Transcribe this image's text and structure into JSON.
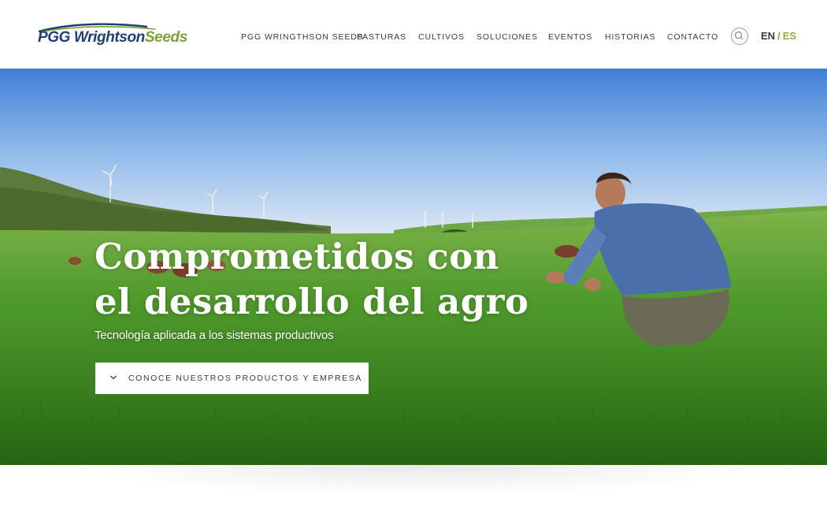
{
  "brand": {
    "name_part1": "PGG Wrightson",
    "name_part2": "Seeds",
    "primary_color": "#1c3f7a",
    "accent_color": "#7aa334"
  },
  "nav": {
    "items": [
      {
        "label": "PGG WRINGTHSON SEEDS"
      },
      {
        "label": "PASTURAS"
      },
      {
        "label": "CULTIVOS"
      },
      {
        "label": "SOLUCIONES"
      },
      {
        "label": "EVENTOS"
      },
      {
        "label": "HISTORIAS"
      },
      {
        "label": "CONTACTO"
      }
    ],
    "search_icon": "search-icon"
  },
  "language": {
    "en": "EN",
    "separator": "/",
    "es": "ES",
    "active": "ES"
  },
  "hero": {
    "title_line1": "Comprometidos con",
    "title_line2": "el desarrollo del agro",
    "subtitle": "Tecnología aplicada a los sistemas productivos",
    "cta_label": "CONOCE NUESTROS PRODUCTOS Y EMPRESA",
    "cta_icon": "chevron-down-icon"
  }
}
